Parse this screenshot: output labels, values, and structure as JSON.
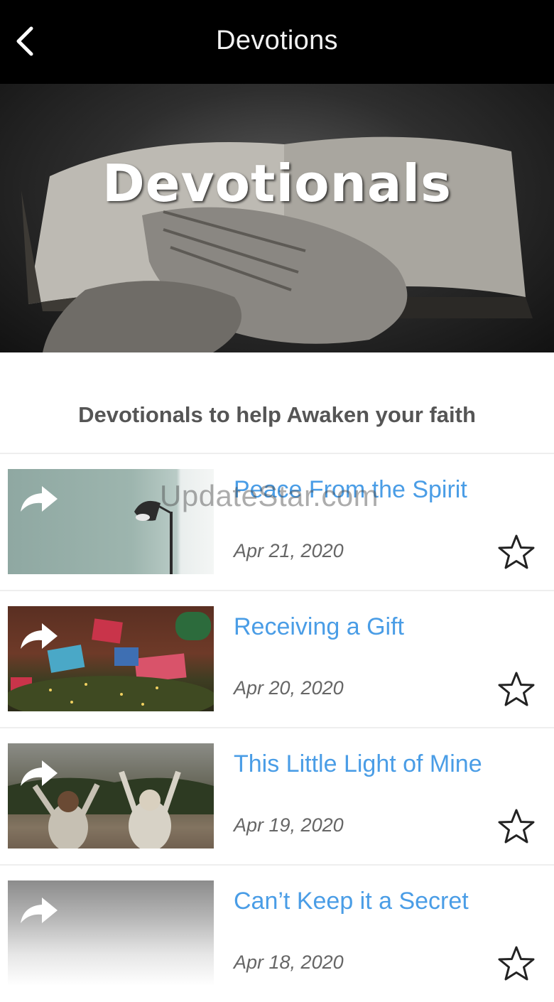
{
  "header": {
    "title": "Devotions",
    "back_icon": "chevron-left-icon"
  },
  "hero": {
    "title": "Devotionals"
  },
  "subtitle": "Devotionals to help Awaken your faith",
  "devotions": [
    {
      "title": "Peace From the Spirit",
      "date": "Apr 21, 2020"
    },
    {
      "title": "Receiving a Gift",
      "date": "Apr 20, 2020"
    },
    {
      "title": "This Little Light of Mine",
      "date": "Apr 19, 2020"
    },
    {
      "title": "Can’t Keep it a Secret",
      "date": "Apr 18, 2020"
    }
  ],
  "watermark": "UpdateStar.com",
  "colors": {
    "accent": "#4a9de6",
    "header_bg": "#000000",
    "date": "#666666"
  }
}
